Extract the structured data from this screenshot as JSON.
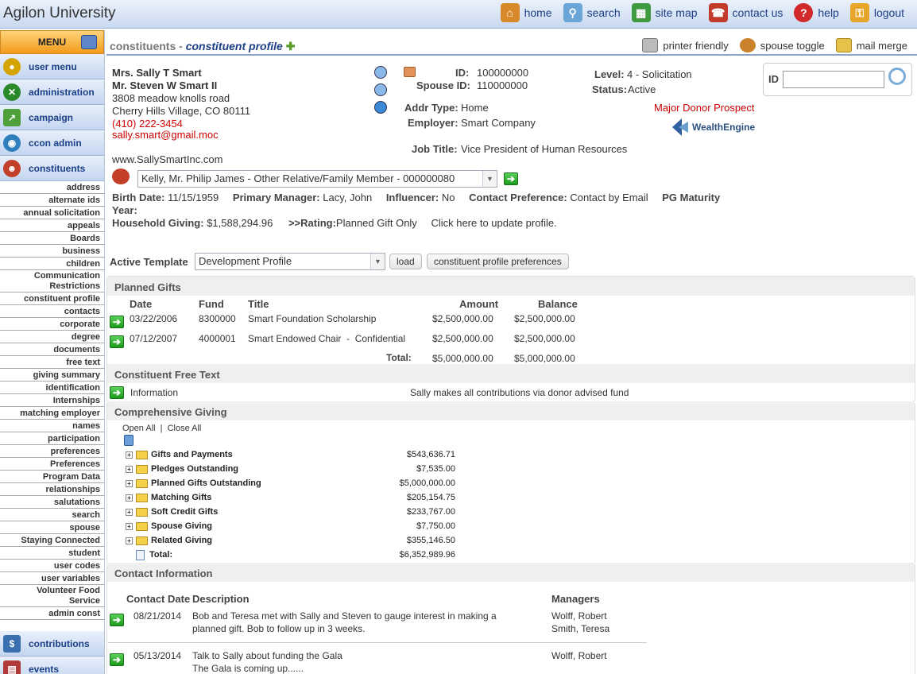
{
  "app": {
    "title": "Agilon University"
  },
  "topnav": [
    {
      "label": "home",
      "icon": "home-icon",
      "color": "#d88a2a"
    },
    {
      "label": "search",
      "icon": "search-icon",
      "color": "#6aa6d8"
    },
    {
      "label": "site map",
      "icon": "sitemap-icon",
      "color": "#3e9a3e"
    },
    {
      "label": "contact us",
      "icon": "contact-icon",
      "color": "#c23b2a"
    },
    {
      "label": "help",
      "icon": "help-icon",
      "color": "#d22a2a"
    },
    {
      "label": "logout",
      "icon": "logout-icon",
      "color": "#e7a52a"
    }
  ],
  "sidebar": {
    "menu_label": "MENU",
    "top_items": [
      {
        "label": "user menu",
        "icon": "user-menu-icon",
        "color": "#d6a400"
      },
      {
        "label": "administration",
        "icon": "administration-icon",
        "color": "#2a8a2a"
      },
      {
        "label": "campaign",
        "icon": "campaign-icon",
        "color": "#4fa03a"
      },
      {
        "label": "ccon admin",
        "icon": "ccon-admin-icon",
        "color": "#2f7fbf"
      },
      {
        "label": "constituents",
        "icon": "constituents-icon",
        "color": "#c2402a"
      }
    ],
    "sub_items": [
      "address",
      "alternate ids",
      "annual solicitation",
      "appeals",
      "Boards",
      "business",
      "children",
      "Communication Restrictions",
      "constituent profile",
      "contacts",
      "corporate",
      "degree",
      "documents",
      "free text",
      "giving summary",
      "identification",
      "Internships",
      "matching employer",
      "names",
      "participation",
      "preferences",
      "Preferences",
      "Program Data",
      "relationships",
      "salutations",
      "search",
      "spouse",
      "Staying Connected",
      "student",
      "user codes",
      "user variables",
      "Volunteer Food Service",
      "admin const"
    ],
    "bottom_items": [
      {
        "label": "contributions",
        "icon": "contributions-icon",
        "color": "#3a6fb0"
      },
      {
        "label": "events",
        "icon": "events-icon",
        "color": "#b03a3a"
      }
    ]
  },
  "header": {
    "section": "constituents",
    "separator": " - ",
    "page": "constituent profile",
    "tools": [
      {
        "label": "printer friendly",
        "icon": "printer-icon"
      },
      {
        "label": "spouse toggle",
        "icon": "spouse-toggle-icon"
      },
      {
        "label": "mail merge",
        "icon": "mail-merge-icon"
      }
    ]
  },
  "profile": {
    "name1": "Mrs. Sally T Smart",
    "name2": "Mr. Steven W Smart II",
    "street": "3808 meadow knolls road",
    "city": "Cherry Hills Village, CO 80111",
    "phone": "(410) 222-3454",
    "email": "sally.smart@gmail.moc",
    "website": "www.SallySmartInc.com",
    "id_label": "ID:",
    "id_value": "100000000",
    "spouse_id_label": "Spouse ID:",
    "spouse_id_value": "110000000",
    "addr_type_label": "Addr Type:",
    "addr_type_value": "Home",
    "employer_label": "Employer:",
    "employer_value": "Smart Company",
    "job_title_label": "Job Title:",
    "job_title_value": "Vice President of Human Resources",
    "level_label": "Level:",
    "level_value": "4 - Solicitation",
    "status_label": "Status:",
    "status_value": "Active",
    "major_donor": "Major Donor Prospect",
    "wealth_engine": "WealthEngine",
    "id_search_label": "ID",
    "id_search_value": "",
    "relation_select": "Kelly, Mr. Philip James - Other Relative/Family Member - 000000080",
    "birth_date_label": "Birth Date:",
    "birth_date_value": "11/15/1959",
    "primary_manager_label": "Primary Manager:",
    "primary_manager_value": "Lacy, John",
    "influencer_label": "Influencer:",
    "influencer_value": "No",
    "contact_pref_label": "Contact Preference:",
    "contact_pref_value": "Contact by Email",
    "pg_maturity_label": "PG Maturity",
    "year_label": "Year:",
    "household_giving_label": "Household Giving:",
    "household_giving_value": "$1,588,294.96",
    "rating_label": ">>Rating:",
    "rating_value": "Planned Gift Only",
    "update_profile": "Click here to update profile."
  },
  "template": {
    "label": "Active Template",
    "value": "Development Profile",
    "load_button": "load",
    "prefs_button": "constituent profile preferences"
  },
  "planned_gifts": {
    "title": "Planned Gifts",
    "headers": [
      "Date",
      "Fund",
      "Title",
      "Amount",
      "Balance"
    ],
    "rows": [
      {
        "date": "03/22/2006",
        "fund": "8300000",
        "title": "Smart Foundation Scholarship",
        "amount": "$2,500,000.00",
        "balance": "$2,500,000.00"
      },
      {
        "date": "07/12/2007",
        "fund": "4000001",
        "title": "Smart Endowed Chair  -  Confidential",
        "amount": "$2,500,000.00",
        "balance": "$2,500,000.00"
      }
    ],
    "total_label": "Total:",
    "total_amount": "$5,000,000.00",
    "total_balance": "$5,000,000.00"
  },
  "free_text": {
    "title": "Constituent Free Text",
    "label": "Information",
    "value": "Sally makes all contributions via donor advised fund"
  },
  "comprehensive": {
    "title": "Comprehensive Giving",
    "open_all": "Open All",
    "close_all": "Close All",
    "separator": "|",
    "rows": [
      {
        "label": "Gifts and Payments",
        "amount": "$543,636.71"
      },
      {
        "label": "Pledges Outstanding",
        "amount": "$7,535.00"
      },
      {
        "label": "Planned Gifts Outstanding",
        "amount": "$5,000,000.00"
      },
      {
        "label": "Matching Gifts",
        "amount": "$205,154.75"
      },
      {
        "label": "Soft Credit Gifts",
        "amount": "$233,767.00"
      },
      {
        "label": "Spouse Giving",
        "amount": "$7,750.00"
      },
      {
        "label": "Related Giving",
        "amount": "$355,146.50"
      }
    ],
    "total_label": "Total:",
    "total_amount": "$6,352,989.96"
  },
  "contact_info": {
    "title": "Contact Information",
    "headers": [
      "Contact Date",
      "Description",
      "Managers"
    ],
    "rows": [
      {
        "date": "08/21/2014",
        "desc1": "Bob and Teresa met with Sally and Steven to gauge interest in making a",
        "desc2": "planned gift. Bob to follow up in 3 weeks.",
        "mgr1": "Wolff, Robert",
        "mgr2": "Smith, Teresa"
      },
      {
        "date": "05/13/2014",
        "desc1": "Talk to Sally about funding the Gala",
        "desc2": "The Gala is coming up......",
        "mgr1": "Wolff, Robert",
        "mgr2": ""
      }
    ]
  }
}
